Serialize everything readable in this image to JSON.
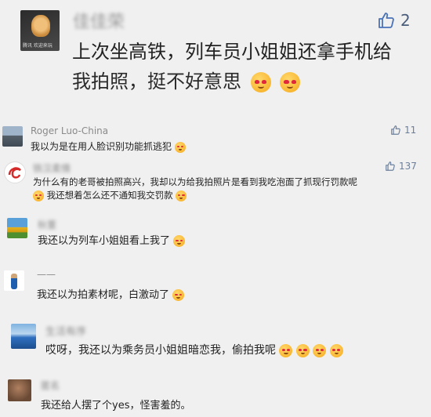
{
  "main_post": {
    "author": "佳佳荣",
    "avatar_caption": "腾讯 欢迎来玩",
    "likes": "2",
    "text_line1": "上次坐高铁，列车员小姐姐还拿手机给",
    "text_line2": "我拍照，挺不好意思"
  },
  "comments": [
    {
      "author": "Roger Luo-China",
      "likes": "11",
      "text": "我以为是在用人脸识别功能抓逃犯"
    },
    {
      "author": "铁汉柔情",
      "likes": "137",
      "text_line1": "为什么有的老哥被拍照高兴，我却以为给我拍照片是看到我吃泡面了抓现行罚款呢",
      "text_line2": "我还想着怎么还不通知我交罚款"
    },
    {
      "author": "秋董",
      "text": "我还以为列车小姐姐看上我了"
    },
    {
      "author": "——",
      "text": "我还以为拍素材呢，白激动了"
    },
    {
      "author": "生活有序",
      "text": "哎呀，我还以为乘务员小姐姐暗恋我，偷拍我呢"
    },
    {
      "author": "匿名",
      "text": "我还给人摆了个yes，怪害羞的。"
    }
  ],
  "colors": {
    "background": "#f0f0f0",
    "name_gray": "#8e8e8e",
    "like_blue": "#6b7f9c"
  }
}
